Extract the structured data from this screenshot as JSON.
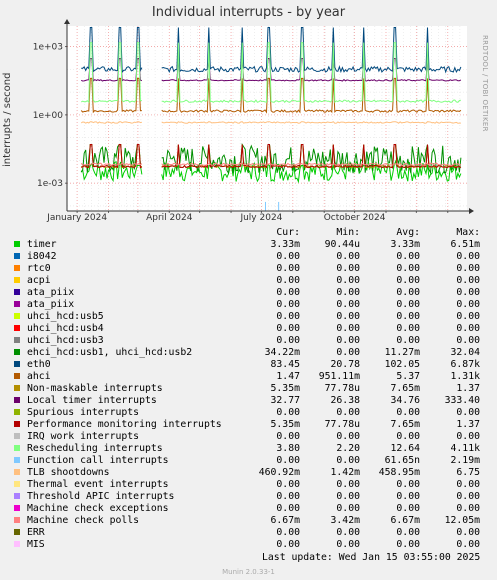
{
  "title": "Individual interrupts - by year",
  "side_text": "RRDTOOL / TOBI OETIKER",
  "footer": "Munin 2.0.33-1",
  "last_update_label": "Last update:",
  "last_update_value": "Wed Jan 15 03:55:00 2025",
  "legend_headers": {
    "cur": "Cur:",
    "min": "Min:",
    "avg": "Avg:",
    "max": "Max:"
  },
  "colors": {
    "background": "#f0f0f0",
    "plot_bg": "#ffffff",
    "grid": "#dddddd",
    "month_grid": "#f2a0a0"
  },
  "chart_data": {
    "type": "line",
    "title": "Individual interrupts - by year",
    "ylabel": "interrupts / second",
    "yscale": "log",
    "ylim": [
      6e-05,
      8000
    ],
    "yticks": [
      {
        "value": 0.001,
        "label": "1e-03"
      },
      {
        "value": 1,
        "label": "1e+00"
      },
      {
        "value": 1000,
        "label": "1e+03"
      }
    ],
    "xlim": [
      "2023-12-22",
      "2025-01-20"
    ],
    "xticks": [
      {
        "date": "2024-01-01",
        "label": "January 2024"
      },
      {
        "date": "2024-04-01",
        "label": "April 2024"
      },
      {
        "date": "2024-07-01",
        "label": "July 2024"
      },
      {
        "date": "2024-10-01",
        "label": "October 2024"
      }
    ],
    "month_starts": [
      "2024-01-01",
      "2024-02-01",
      "2024-03-01",
      "2024-04-01",
      "2024-05-01",
      "2024-06-01",
      "2024-07-01",
      "2024-08-01",
      "2024-09-01",
      "2024-10-01",
      "2024-11-01",
      "2024-12-01",
      "2025-01-01"
    ],
    "gap": [
      "2024-03-06",
      "2024-03-24"
    ],
    "spike_dates": [
      "2024-01-15",
      "2024-02-12",
      "2024-03-01",
      "2024-04-10",
      "2024-05-10",
      "2024-06-12",
      "2024-07-08",
      "2024-08-10",
      "2024-09-10",
      "2024-10-10",
      "2024-11-10",
      "2024-12-12"
    ],
    "series": [
      {
        "name": "timer",
        "color": "#00cc00",
        "cur": "3.33m",
        "min": "90.44u",
        "avg": "3.33m",
        "max": "6.51m",
        "plotted": true,
        "base": 0.0033,
        "noise": 0.45,
        "spike": 0.006
      },
      {
        "name": "i8042",
        "color": "#0066b3",
        "cur": "0.00",
        "min": "0.00",
        "avg": "0.00",
        "max": "0.00"
      },
      {
        "name": "rtc0",
        "color": "#ff8000",
        "cur": "0.00",
        "min": "0.00",
        "avg": "0.00",
        "max": "0.00"
      },
      {
        "name": "acpi",
        "color": "#ffcc00",
        "cur": "0.00",
        "min": "0.00",
        "avg": "0.00",
        "max": "0.00"
      },
      {
        "name": "ata_piix",
        "color": "#330099",
        "cur": "0.00",
        "min": "0.00",
        "avg": "0.00",
        "max": "0.00"
      },
      {
        "name": "ata_piix",
        "color": "#990099",
        "cur": "0.00",
        "min": "0.00",
        "avg": "0.00",
        "max": "0.00"
      },
      {
        "name": "uhci_hcd:usb5",
        "color": "#ccff00",
        "cur": "0.00",
        "min": "0.00",
        "avg": "0.00",
        "max": "0.00"
      },
      {
        "name": "uhci_hcd:usb4",
        "color": "#ff0000",
        "cur": "0.00",
        "min": "0.00",
        "avg": "0.00",
        "max": "0.00"
      },
      {
        "name": "uhci_hcd:usb3",
        "color": "#808080",
        "cur": "0.00",
        "min": "0.00",
        "avg": "0.00",
        "max": "0.00"
      },
      {
        "name": "ehci_hcd:usb1, uhci_hcd:usb2",
        "color": "#008f00",
        "cur": "34.22m",
        "min": "0.00",
        "avg": "11.27m",
        "max": "32.04",
        "plotted": true,
        "base": 0.011,
        "noise": 0.6,
        "spike": 0.05
      },
      {
        "name": "eth0",
        "color": "#00487d",
        "cur": "83.45",
        "min": "20.78",
        "avg": "102.05",
        "max": "6.87k",
        "plotted": true,
        "base": 100,
        "noise": 0.12,
        "spike": 6870
      },
      {
        "name": "ahci",
        "color": "#b35a00",
        "cur": "1.47",
        "min": "951.11m",
        "avg": "5.37",
        "max": "1.31k",
        "plotted": true,
        "base": 1.47,
        "noise": 0.05,
        "spike": 40
      },
      {
        "name": "Non-maskable interrupts",
        "color": "#b38f00",
        "cur": "5.35m",
        "min": "77.78u",
        "avg": "7.65m",
        "max": "1.37",
        "plotted": true,
        "base": 0.0054,
        "noise": 0.05,
        "spike": 0.05
      },
      {
        "name": "Local timer interrupts",
        "color": "#6b006b",
        "cur": "32.77",
        "min": "26.38",
        "avg": "34.76",
        "max": "333.40",
        "plotted": true,
        "base": 33,
        "noise": 0.03,
        "spike": 300
      },
      {
        "name": "Spurious interrupts",
        "color": "#8fb300",
        "cur": "0.00",
        "min": "0.00",
        "avg": "0.00",
        "max": "0.00"
      },
      {
        "name": "Performance monitoring interrupts",
        "color": "#b30000",
        "cur": "5.35m",
        "min": "77.78u",
        "avg": "7.65m",
        "max": "1.37",
        "plotted": true,
        "base": 0.0054,
        "noise": 0.05,
        "spike": 0.05
      },
      {
        "name": "IRQ work interrupts",
        "color": "#bebebe",
        "cur": "0.00",
        "min": "0.00",
        "avg": "0.00",
        "max": "0.00"
      },
      {
        "name": "Rescheduling interrupts",
        "color": "#80ff80",
        "cur": "3.80",
        "min": "2.20",
        "avg": "12.64",
        "max": "4.11k",
        "plotted": true,
        "base": 4,
        "noise": 0.05,
        "spike": 1500
      },
      {
        "name": "Function call interrupts",
        "color": "#80c9ff",
        "cur": "0.00",
        "min": "0.00",
        "avg": "61.65n",
        "max": "2.19m",
        "plotted": true,
        "base": 0,
        "noise": 0,
        "spike": 0.00015
      },
      {
        "name": "TLB shootdowns",
        "color": "#ffc080",
        "cur": "460.92m",
        "min": "1.42m",
        "avg": "458.95m",
        "max": "6.75",
        "plotted": true,
        "base": 0.46,
        "noise": 0.03,
        "spike": 0.5
      },
      {
        "name": "Thermal event interrupts",
        "color": "#ffe680",
        "cur": "0.00",
        "min": "0.00",
        "avg": "0.00",
        "max": "0.00"
      },
      {
        "name": "Threshold APIC interrupts",
        "color": "#aa80ff",
        "cur": "0.00",
        "min": "0.00",
        "avg": "0.00",
        "max": "0.00"
      },
      {
        "name": "Machine check exceptions",
        "color": "#ee00cc",
        "cur": "0.00",
        "min": "0.00",
        "avg": "0.00",
        "max": "0.00"
      },
      {
        "name": "Machine check polls",
        "color": "#ff8080",
        "cur": "6.67m",
        "min": "3.42m",
        "avg": "6.67m",
        "max": "12.05m",
        "plotted": true,
        "base": 0.0067,
        "noise": 0.05,
        "spike": 0.0067
      },
      {
        "name": "ERR",
        "color": "#666600",
        "cur": "0.00",
        "min": "0.00",
        "avg": "0.00",
        "max": "0.00"
      },
      {
        "name": "MIS",
        "color": "#ffbfff",
        "cur": "0.00",
        "min": "0.00",
        "avg": "0.00",
        "max": "0.00"
      }
    ]
  }
}
